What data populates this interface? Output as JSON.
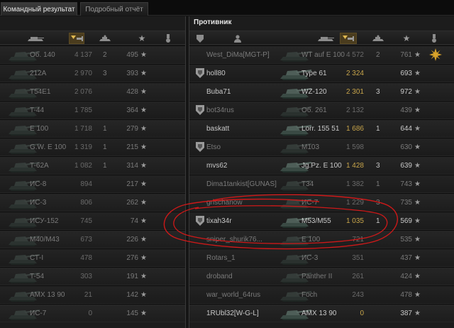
{
  "tabs": [
    {
      "label": "Командный результат",
      "active": true
    },
    {
      "label": "Подробный отчёт",
      "active": false
    }
  ],
  "enemy_title": "Противник",
  "left_rows": [
    {
      "tank": "Об. 140",
      "dmg": "4 137",
      "kills": "2",
      "xp": "495",
      "dead": true
    },
    {
      "tank": "212A",
      "dmg": "2 970",
      "kills": "3",
      "xp": "393",
      "dead": true
    },
    {
      "tank": "T54E1",
      "dmg": "2 076",
      "kills": "",
      "xp": "428",
      "dead": true
    },
    {
      "tank": "T-44",
      "dmg": "1 785",
      "kills": "",
      "xp": "364",
      "dead": true
    },
    {
      "tank": "E 100",
      "dmg": "1 718",
      "kills": "1",
      "xp": "279",
      "dead": true
    },
    {
      "tank": "G.W. E 100",
      "dmg": "1 319",
      "kills": "1",
      "xp": "215",
      "dead": true
    },
    {
      "tank": "T-62A",
      "dmg": "1 082",
      "kills": "1",
      "xp": "314",
      "dead": true
    },
    {
      "tank": "ИС-8",
      "dmg": "894",
      "kills": "",
      "xp": "217",
      "dead": true
    },
    {
      "tank": "ИС-3",
      "dmg": "806",
      "kills": "",
      "xp": "262",
      "dead": true
    },
    {
      "tank": "ИСУ-152",
      "dmg": "745",
      "kills": "",
      "xp": "74",
      "dead": true
    },
    {
      "tank": "M40/M43",
      "dmg": "673",
      "kills": "",
      "xp": "226",
      "dead": true
    },
    {
      "tank": "СТ-I",
      "dmg": "478",
      "kills": "",
      "xp": "276",
      "dead": true
    },
    {
      "tank": "T-54",
      "dmg": "303",
      "kills": "",
      "xp": "191",
      "dead": true
    },
    {
      "tank": "AMX 13 90",
      "dmg": "21",
      "kills": "",
      "xp": "142",
      "dead": true
    },
    {
      "tank": "ИС-7",
      "dmg": "0",
      "kills": "",
      "xp": "145",
      "dead": true
    }
  ],
  "right_rows": [
    {
      "player": "West_DiMa[MGT-P]",
      "tank": "WT auf E 100",
      "dmg": "4 572",
      "kills": "2",
      "xp": "761",
      "dead": true,
      "badge": false,
      "medal": true
    },
    {
      "player": "holl80",
      "tank": "Type 61",
      "dmg": "2 324",
      "kills": "",
      "xp": "693",
      "dead": false,
      "badge": true,
      "medal": false
    },
    {
      "player": "Buba71",
      "tank": "WZ-120",
      "dmg": "2 301",
      "kills": "3",
      "xp": "972",
      "dead": false,
      "badge": false,
      "medal": false
    },
    {
      "player": "bot34rus",
      "tank": "Об. 261",
      "dmg": "2 132",
      "kills": "",
      "xp": "439",
      "dead": true,
      "badge": true,
      "medal": false
    },
    {
      "player": "baskatt",
      "tank": "Lorr. 155 51",
      "dmg": "1 686",
      "kills": "1",
      "xp": "644",
      "dead": false,
      "badge": false,
      "medal": false
    },
    {
      "player": "Etso",
      "tank": "M103",
      "dmg": "1 598",
      "kills": "",
      "xp": "630",
      "dead": true,
      "badge": true,
      "medal": false
    },
    {
      "player": "mvs62",
      "tank": "Jg.Pz. E 100",
      "dmg": "1 428",
      "kills": "3",
      "xp": "639",
      "dead": false,
      "badge": false,
      "medal": false
    },
    {
      "player": "Dima1tankist[GUNAS]",
      "tank": "T34",
      "dmg": "1 382",
      "kills": "1",
      "xp": "743",
      "dead": true,
      "badge": false,
      "medal": false
    },
    {
      "player": "grischanow",
      "tank": "ИС-7",
      "dmg": "1 229",
      "kills": "3",
      "xp": "735",
      "dead": true,
      "badge": false,
      "medal": false
    },
    {
      "player": "tixah34r",
      "tank": "M53/M55",
      "dmg": "1 035",
      "kills": "1",
      "xp": "569",
      "dead": false,
      "badge": true,
      "medal": false
    },
    {
      "player": "sniper_shurik76...",
      "tank": "E 100",
      "dmg": "721",
      "kills": "",
      "xp": "535",
      "dead": true,
      "badge": false,
      "medal": false
    },
    {
      "player": "Rotars_1",
      "tank": "ИС-3",
      "dmg": "351",
      "kills": "",
      "xp": "437",
      "dead": true,
      "badge": false,
      "medal": false
    },
    {
      "player": "droband",
      "tank": "Panther II",
      "dmg": "261",
      "kills": "",
      "xp": "424",
      "dead": true,
      "badge": false,
      "medal": false
    },
    {
      "player": "war_world_64rus",
      "tank": "Foch",
      "dmg": "243",
      "kills": "",
      "xp": "478",
      "dead": true,
      "badge": false,
      "medal": false
    },
    {
      "player": "1RUbl32[W-G-L]",
      "tank": "AMX 13 90",
      "dmg": "0",
      "kills": "",
      "xp": "387",
      "dead": false,
      "badge": false,
      "medal": false
    }
  ],
  "colors": {
    "damage_gold": "#c7a44a",
    "annotation_red": "#e01818"
  },
  "icons": {
    "tank_header": "tank-icon",
    "sort_marker": "sort-chevron-icon",
    "damage_header": "damage-icon",
    "kills_header": "destroyed-tank-icon",
    "xp_header": "star-icon",
    "medal_header": "medal-icon",
    "platoon_header": "platoon-icon",
    "player_header": "player-icon"
  }
}
